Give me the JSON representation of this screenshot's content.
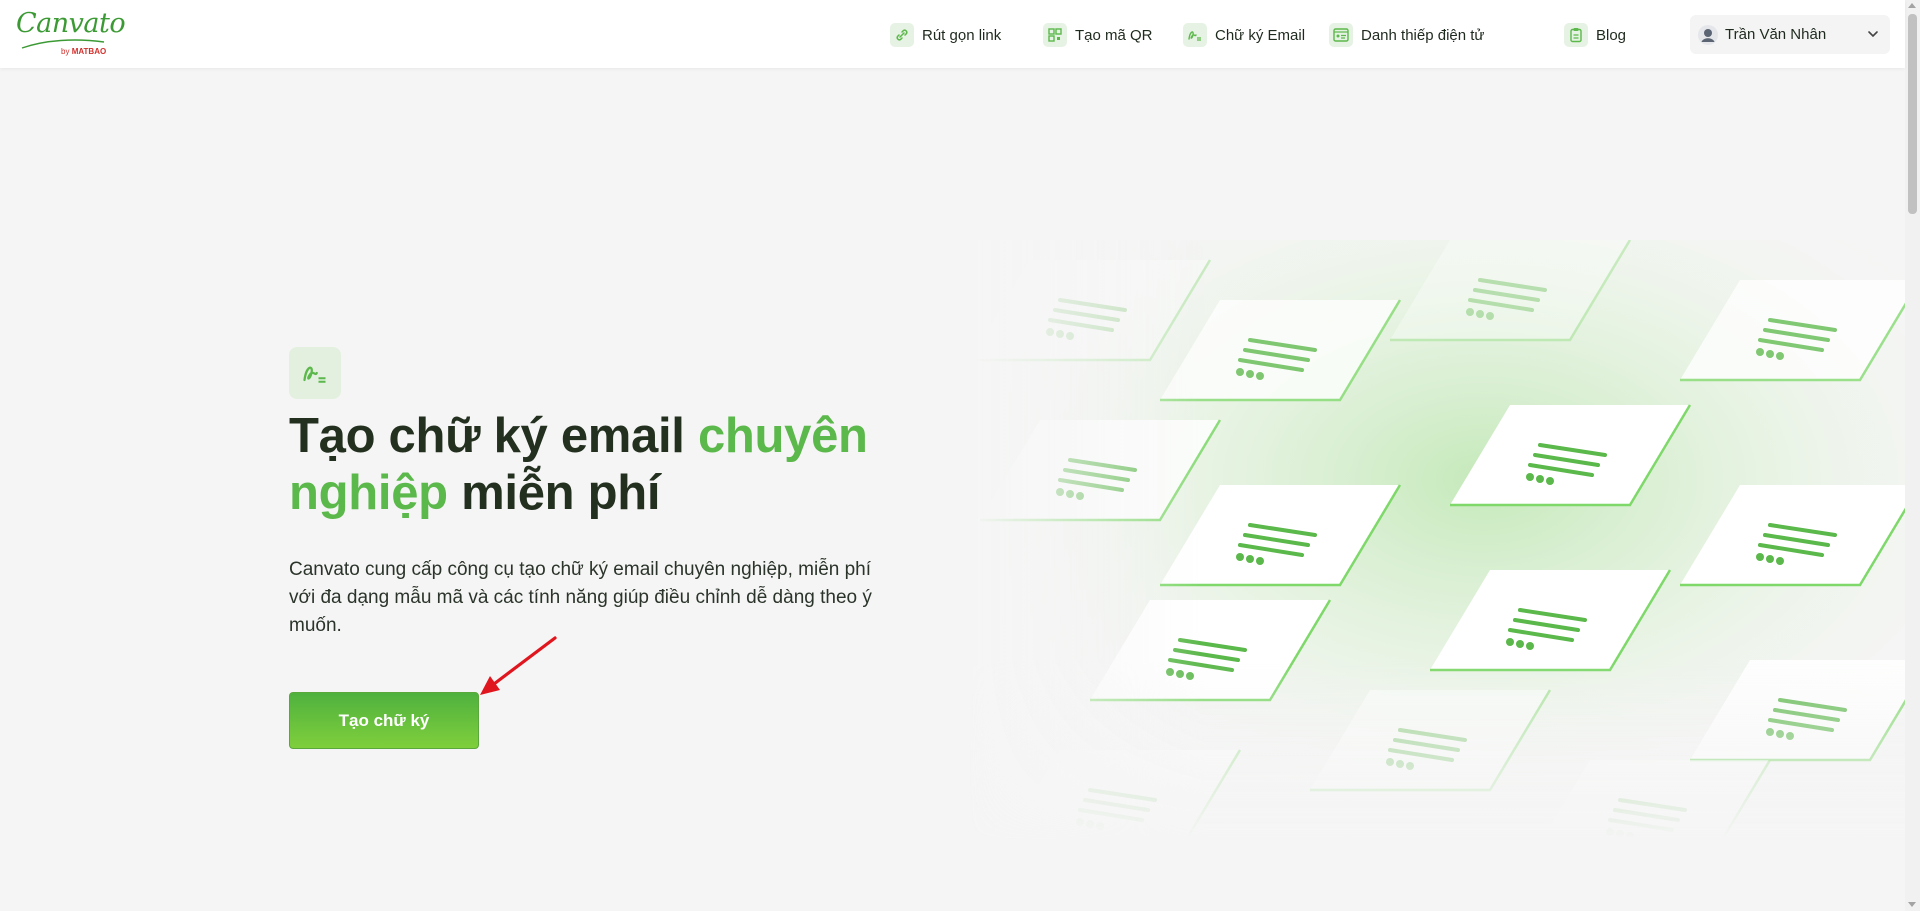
{
  "header": {
    "logo": {
      "text": "Canvato",
      "by": "by",
      "brand": "MATBAO"
    },
    "nav": [
      {
        "label": "Rút gọn link",
        "icon": "link-icon"
      },
      {
        "label": "Tạo mã QR",
        "icon": "qr-code-icon"
      },
      {
        "label": "Chữ ký Email",
        "icon": "signature-icon"
      },
      {
        "label": "Danh thiếp điện tử",
        "icon": "business-card-icon"
      },
      {
        "label": "Blog",
        "icon": "clipboard-icon"
      }
    ],
    "user": {
      "name": "Trần Văn Nhân",
      "icon": "user-avatar-icon"
    }
  },
  "hero": {
    "icon": "signature-icon",
    "title_part1": "Tạo chữ ký email ",
    "title_highlight": "chuyên nghiệp",
    "title_part2": " miễn phí",
    "description": "Canvato cung cấp công cụ tạo chữ ký email chuyên nghiệp, miễn phí với đa dạng mẫu mã và các tính năng giúp điều chỉnh dễ dàng theo ý muốn.",
    "cta_label": "Tạo chữ ký"
  },
  "colors": {
    "accent": "#5bb84a",
    "cta_gradient_start": "#4fb13e",
    "cta_gradient_end": "#7fcf3c",
    "title": "#23301f",
    "background": "#f5f5f5",
    "annotation_arrow": "#e0161e"
  }
}
